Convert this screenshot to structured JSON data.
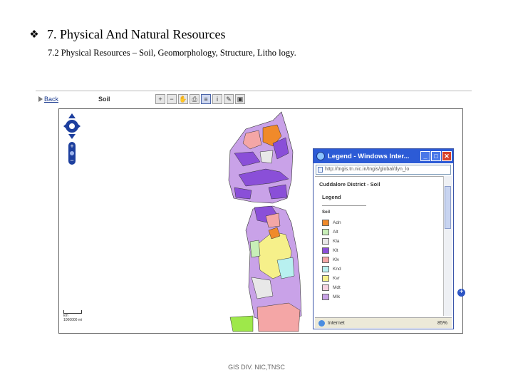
{
  "slide": {
    "bullet_icon": "diamond-bullet-icon",
    "title": "7. Physical And Natural Resources",
    "subtitle": "7.2 Physical Resources – Soil, Geomorphology, Structure, Litho logy."
  },
  "toolbar": {
    "back_label": "Back",
    "layer_label": "Soil",
    "tools": [
      {
        "icon": "zoom-in-icon",
        "glyph": "+"
      },
      {
        "icon": "zoom-out-icon",
        "glyph": "−"
      },
      {
        "icon": "pan-icon",
        "glyph": "✋"
      },
      {
        "icon": "print-icon",
        "glyph": "⎙"
      },
      {
        "icon": "legend-icon",
        "glyph": "≡"
      },
      {
        "icon": "identify-icon",
        "glyph": "i"
      },
      {
        "icon": "measure-icon",
        "glyph": "✎"
      },
      {
        "icon": "overview-icon",
        "glyph": "▣"
      }
    ]
  },
  "map": {
    "scale_text": "1000000 mi",
    "scale_unit": "km"
  },
  "legend_window": {
    "title": "Legend - Windows Inter...",
    "address": "http://tngis.tn.nic.in/tngis/global/dyn_lo",
    "doc_title": "Cuddalore District - Soil",
    "legend_heading": "Legend",
    "group_label": "Soil",
    "items": [
      {
        "label": "Adn",
        "color": "#f08a2a"
      },
      {
        "label": "Alt",
        "color": "#c8efb8"
      },
      {
        "label": "Kla",
        "color": "#e8e8e8"
      },
      {
        "label": "Klt",
        "color": "#8a4fd8"
      },
      {
        "label": "Klv",
        "color": "#f4a6a6"
      },
      {
        "label": "Knd",
        "color": "#b8f0f0"
      },
      {
        "label": "Kvr",
        "color": "#f6f08a"
      },
      {
        "label": "Mdt",
        "color": "#f6d2e0"
      },
      {
        "label": "Mlk",
        "color": "#c9a2e8"
      }
    ],
    "status_text": "Internet",
    "zoom_text": "85%"
  },
  "footer": "GIS DIV. NIC,TNSC"
}
